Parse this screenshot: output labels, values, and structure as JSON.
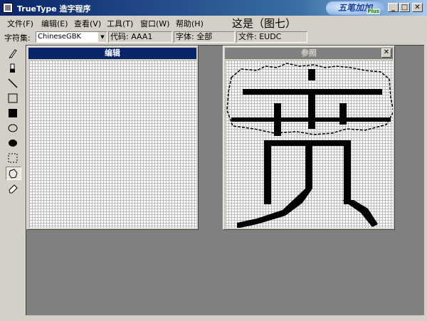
{
  "window": {
    "title": "TrueType 造字程序",
    "logo_text": "五笔加加",
    "logo_sub": "Plus",
    "caption_center": "这是（图七）",
    "minimize_glyph": "_",
    "maximize_glyph": "□",
    "close_glyph": "✕"
  },
  "menu": [
    {
      "label": "文件(F)"
    },
    {
      "label": "编辑(E)"
    },
    {
      "label": "查看(V)"
    },
    {
      "label": "工具(T)"
    },
    {
      "label": "窗口(W)"
    },
    {
      "label": "帮助(H)"
    }
  ],
  "infobar": {
    "charset_label": "字符集:",
    "charset_value": "ChineseGBK",
    "code": "代码: AAA1",
    "font": "字体: 全部",
    "file": "文件: EUDC"
  },
  "tools": [
    {
      "name": "pencil-icon"
    },
    {
      "name": "brush-icon"
    },
    {
      "name": "line-icon"
    },
    {
      "name": "hollow-rectangle-icon"
    },
    {
      "name": "filled-rectangle-icon"
    },
    {
      "name": "hollow-ellipse-icon"
    },
    {
      "name": "filled-ellipse-icon"
    },
    {
      "name": "rect-select-icon"
    },
    {
      "name": "freeform-select-icon",
      "active": true
    },
    {
      "name": "eraser-icon"
    }
  ],
  "edit_window": {
    "title": "编辑"
  },
  "reference_window": {
    "title": "参照",
    "close_glyph": "✕"
  },
  "colors": {
    "titlebar_start": "#0a246a",
    "titlebar_end": "#a6caf0",
    "face": "#d4d0c8",
    "mdi_background": "#808080",
    "grid_line": "#b8b8b8",
    "pixel_on": "#000000"
  }
}
